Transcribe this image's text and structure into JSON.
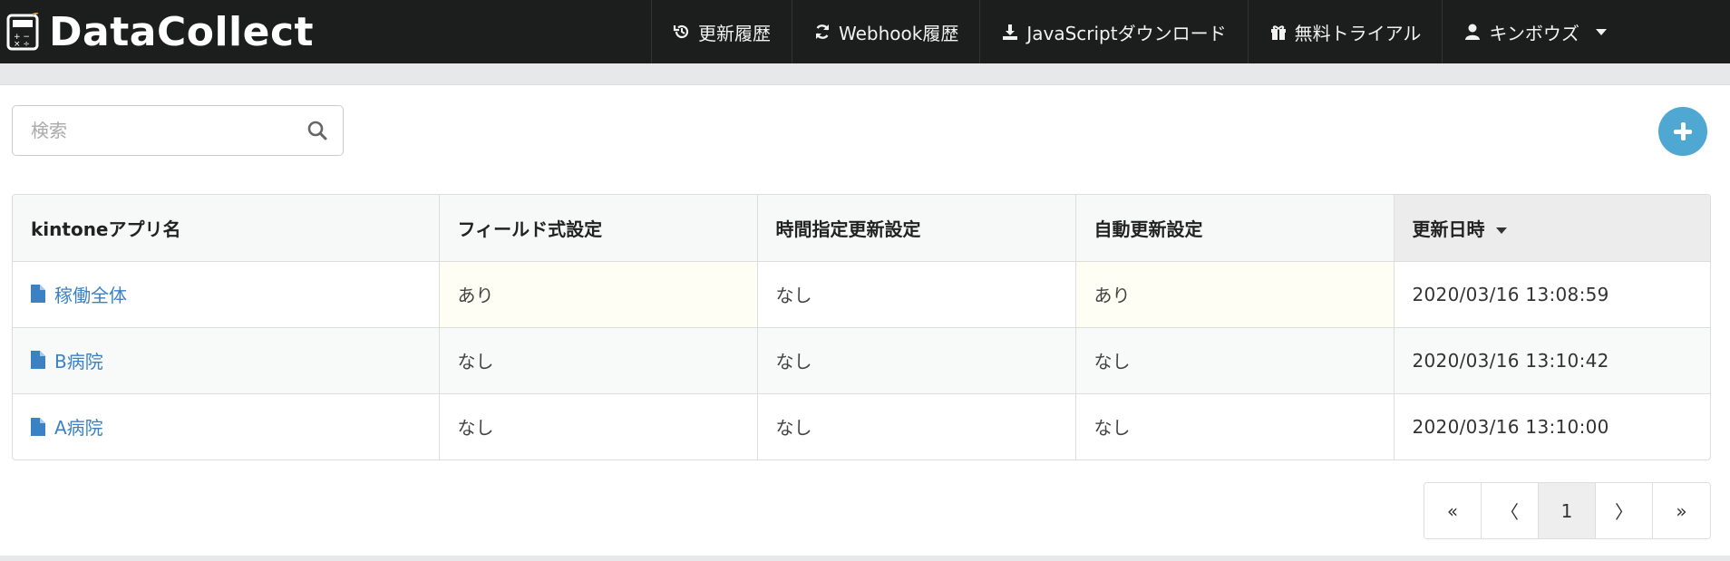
{
  "header": {
    "brand": "DataCollect",
    "nav": [
      {
        "label": "更新履歴",
        "icon": "history-icon"
      },
      {
        "label": "Webhook履歴",
        "icon": "refresh-icon"
      },
      {
        "label": "JavaScriptダウンロード",
        "icon": "download-icon"
      },
      {
        "label": "無料トライアル",
        "icon": "gift-icon"
      }
    ],
    "user": {
      "label": "キンボウズ",
      "icon": "user-icon"
    }
  },
  "search": {
    "placeholder": "検索",
    "value": ""
  },
  "add_button": {
    "icon": "plus-icon",
    "color": "#4ea8d2"
  },
  "table": {
    "columns": [
      {
        "label": "kintoneアプリ名"
      },
      {
        "label": "フィールド式設定"
      },
      {
        "label": "時間指定更新設定"
      },
      {
        "label": "自動更新設定"
      },
      {
        "label": "更新日時",
        "sorted": "desc"
      }
    ],
    "rows": [
      {
        "name": "稼働全体",
        "field": "あり",
        "time": "なし",
        "auto": "あり",
        "updated": "2020/03/16 13:08:59"
      },
      {
        "name": "B病院",
        "field": "なし",
        "time": "なし",
        "auto": "なし",
        "updated": "2020/03/16 13:10:42"
      },
      {
        "name": "A病院",
        "field": "なし",
        "time": "なし",
        "auto": "なし",
        "updated": "2020/03/16 13:10:00"
      }
    ]
  },
  "pagination": {
    "first": "«",
    "prev": "〈",
    "current": "1",
    "next": "〉",
    "last": "»"
  },
  "colors": {
    "topbar": "#1c1d1d",
    "link": "#3b82c4",
    "highlight_cell": "#fefef4"
  }
}
